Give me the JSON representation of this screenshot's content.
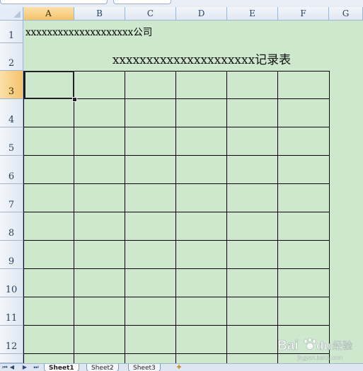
{
  "columns": [
    "A",
    "B",
    "C",
    "D",
    "E",
    "F",
    "G"
  ],
  "active_column": "A",
  "rows": [
    "1",
    "2",
    "3",
    "4",
    "5",
    "6",
    "7",
    "8",
    "9",
    "10",
    "11",
    "12"
  ],
  "active_row": "3",
  "cells": {
    "A1": "xxxxxxxxxxxxxxxxxxxx公司",
    "B2": "xxxxxxxxxxxxxxxxxxxxx记录表"
  },
  "sheet_tabs": [
    "Sheet1",
    "Sheet2",
    "Sheet3"
  ],
  "active_sheet": "Sheet1",
  "colors": {
    "sheet_background": "#cde8cc",
    "header_background": "#dfe7f2",
    "active_header": "#f6c36b",
    "grid_border": "#000000"
  },
  "icons": [
    "select-all-triangle-icon",
    "tab-first-icon",
    "tab-prev-icon",
    "tab-next-icon",
    "tab-last-icon",
    "insert-sheet-icon",
    "baidu-paw-icon"
  ],
  "watermark": {
    "brand": "Bai",
    "brand_suffix": "du",
    "product": "经验",
    "site": "jingyan.baidu.com"
  }
}
